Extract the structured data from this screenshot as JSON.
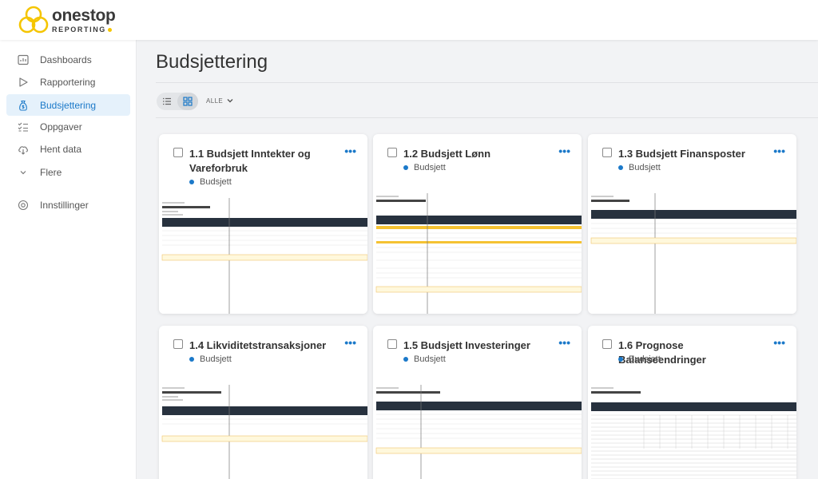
{
  "app": {
    "logo_main": "onestop",
    "logo_sub": "REPORTING",
    "brand_color": "#f5c500",
    "accent_color": "#1b79c9"
  },
  "sidebar": {
    "items": [
      {
        "label": "Dashboards",
        "icon": "dashboard-icon",
        "active": false
      },
      {
        "label": "Rapportering",
        "icon": "play-icon",
        "active": false
      },
      {
        "label": "Budsjettering",
        "icon": "money-bag-icon",
        "active": true
      },
      {
        "label": "Oppgaver",
        "icon": "checklist-icon",
        "active": false
      },
      {
        "label": "Hent data",
        "icon": "cloud-download-icon",
        "active": false
      },
      {
        "label": "Flere",
        "icon": "chevron-down-icon",
        "active": false
      },
      {
        "label": "Innstillinger",
        "icon": "gear-icon",
        "active": false
      }
    ]
  },
  "main": {
    "title": "Budsjettering",
    "filter_label": "ALLE",
    "view_modes": [
      "list-view-icon",
      "grid-view-icon"
    ],
    "active_view": "grid"
  },
  "cards": [
    {
      "title": "1.1 Budsjett Inntekter og Vareforbruk",
      "status": "Budsjett",
      "menu": "•••"
    },
    {
      "title": "1.2 Budsjett Lønn",
      "status": "Budsjett",
      "menu": "•••"
    },
    {
      "title": "1.3 Budsjett Finansposter",
      "status": "Budsjett",
      "menu": "•••"
    },
    {
      "title": "1.4 Likviditetstransaksjoner",
      "status": "Budsjett",
      "menu": "•••"
    },
    {
      "title": "1.5 Budsjett Investeringer",
      "status": "Budsjett",
      "menu": "•••"
    },
    {
      "title": "1.6 Prognose Balanseendringer",
      "status": "Budsjett",
      "menu": "•••"
    }
  ]
}
